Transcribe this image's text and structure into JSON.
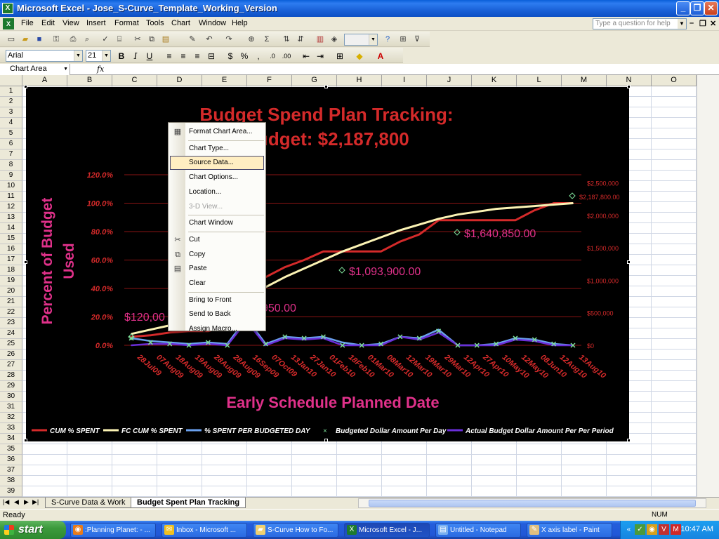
{
  "window": {
    "title": "Microsoft Excel - Jose_S-Curve_Template_Working_Version",
    "app_icon": "excel-icon"
  },
  "menu": {
    "items": [
      "File",
      "Edit",
      "View",
      "Insert",
      "Format",
      "Tools",
      "Chart",
      "Window",
      "Help"
    ],
    "ask_placeholder": "Type a question for help"
  },
  "format_toolbar": {
    "font": "Arial",
    "size": "21"
  },
  "formula_bar": {
    "name_box": "Chart Area",
    "fx": "fx"
  },
  "columns": [
    "A",
    "B",
    "C",
    "D",
    "E",
    "F",
    "G",
    "H",
    "I",
    "J",
    "K",
    "L",
    "M",
    "N",
    "O"
  ],
  "rows": [
    "1",
    "2",
    "3",
    "4",
    "5",
    "6",
    "7",
    "8",
    "9",
    "10",
    "11",
    "12",
    "13",
    "14",
    "15",
    "16",
    "17",
    "18",
    "19",
    "20",
    "21",
    "22",
    "23",
    "24",
    "25",
    "26",
    "27",
    "28",
    "29",
    "30",
    "31",
    "32",
    "33",
    "34",
    "35",
    "36",
    "37",
    "38",
    "39"
  ],
  "context_menu": {
    "items": [
      {
        "label": "Format Chart Area...",
        "icon": "format-chart-icon",
        "state": "normal"
      },
      {
        "label": "Chart Type...",
        "icon": "",
        "state": "normal"
      },
      {
        "label": "Source Data...",
        "icon": "",
        "state": "hover"
      },
      {
        "label": "Chart Options...",
        "icon": "",
        "state": "normal"
      },
      {
        "label": "Location...",
        "icon": "",
        "state": "normal"
      },
      {
        "label": "3-D View...",
        "icon": "",
        "state": "disabled"
      },
      {
        "label": "Chart Window",
        "icon": "",
        "state": "normal"
      },
      {
        "label": "Cut",
        "icon": "scissors-icon",
        "state": "normal"
      },
      {
        "label": "Copy",
        "icon": "copy-icon",
        "state": "normal"
      },
      {
        "label": "Paste",
        "icon": "paste-icon",
        "state": "normal"
      },
      {
        "label": "Clear",
        "icon": "",
        "state": "normal"
      },
      {
        "label": "Bring to Front",
        "icon": "",
        "state": "normal"
      },
      {
        "label": "Send to Back",
        "icon": "",
        "state": "normal"
      },
      {
        "label": "Assign Macro...",
        "icon": "",
        "state": "normal"
      }
    ]
  },
  "sheet_tabs": {
    "tabs": [
      "S-Curve Data & Work",
      "Budget Spent Plan Tracking"
    ],
    "active": 1
  },
  "status": {
    "text": "Ready",
    "num": "NUM"
  },
  "taskbar": {
    "start": "start",
    "tasks": [
      {
        "label": ":Planning Planet: - ...",
        "icon": "firefox-icon"
      },
      {
        "label": "Inbox - Microsoft ...",
        "icon": "outlook-icon"
      },
      {
        "label": "S-Curve How to Fo...",
        "icon": "folder-icon"
      },
      {
        "label": "Microsoft Excel - J...",
        "icon": "excel-icon"
      },
      {
        "label": "Untitled - Notepad",
        "icon": "notepad-icon"
      },
      {
        "label": "X axis label - Paint",
        "icon": "paint-icon"
      }
    ],
    "active_task": 3,
    "clock": "10:47 AM"
  },
  "chart_data": {
    "type": "line",
    "title_line1": "Budget Spend Plan Tracking:",
    "title_line2": "Budget: $2,187,800",
    "ylabel": "Percent of Budget Used",
    "xlabel": "Early Schedule Planned Date",
    "y_left_ticks": [
      "0.0%",
      "20.0%",
      "40.0%",
      "60.0%",
      "80.0%",
      "100.0%",
      "120.0%"
    ],
    "y_right_ticks": [
      "$0",
      "$500,000",
      "$1,000,000",
      "$1,500,000",
      "$2,000,000",
      "$2,500,000"
    ],
    "ylim": [
      0,
      1.2
    ],
    "categories": [
      "28Jul09",
      "07Aug09",
      "18Aug09",
      "19Aug09",
      "28Aug09",
      "28Aug09",
      "16Sep09",
      "07Oct09",
      "13Jan10",
      "27Jan10",
      "01Feb10",
      "18Feb10",
      "01Mar10",
      "08Mar10",
      "12Mar10",
      "19Mar10",
      "29Mar10",
      "12Apr10",
      "27Apr10",
      "10May10",
      "12May10",
      "08Jun10",
      "12Aug10",
      "13Aug10"
    ],
    "visible_tick_labels": [
      "28Jul09",
      "07Aug09",
      "18Aug09",
      "19Aug09",
      "28Aug09",
      "28Aug09",
      "16Sep09",
      "07Oct09",
      "13Jan10",
      "27Jan10",
      "01Feb10",
      "18Feb10",
      "01Mar10",
      "08Mar10",
      "12Mar10",
      "19Mar10",
      "29Mar10",
      "12Apr10",
      "27Apr10",
      "10May10",
      "12May10",
      "08Jun10",
      "12Aug10",
      "13Aug10"
    ],
    "series": [
      {
        "name": "CUM % SPENT",
        "color": "#d42a2a",
        "dash": "solid",
        "values": [
          0.06,
          0.07,
          0.09,
          0.1,
          0.1,
          0.14,
          0.47,
          0.48,
          0.55,
          0.6,
          0.66,
          0.66,
          0.66,
          0.66,
          0.73,
          0.78,
          0.88,
          0.88,
          0.88,
          0.88,
          0.88,
          0.95,
          1.0,
          1.0
        ]
      },
      {
        "name": "FC CUM % SPENT",
        "color": "#fbf3b4",
        "dash": "solid",
        "values": [
          0.08,
          0.11,
          0.14,
          0.17,
          0.21,
          0.25,
          0.34,
          0.41,
          0.48,
          0.54,
          0.6,
          0.66,
          0.71,
          0.76,
          0.81,
          0.85,
          0.89,
          0.92,
          0.94,
          0.96,
          0.97,
          0.98,
          0.99,
          1.0
        ]
      },
      {
        "name": "% SPENT PER BUDGETED DAY",
        "color": "#6aa0ee",
        "dash": "solid",
        "values": [
          0.05,
          0.03,
          0.02,
          0.01,
          0.02,
          0.01,
          0.19,
          0.01,
          0.06,
          0.05,
          0.06,
          0.02,
          0.0,
          0.01,
          0.06,
          0.05,
          0.11,
          0.0,
          0.0,
          0.01,
          0.05,
          0.04,
          0.01,
          0.0
        ]
      },
      {
        "name": "Actual Budget Dollar Amount Per Per Period",
        "color": "#6a2ed8",
        "dash": "solid",
        "values": [
          0.0,
          0.01,
          0.01,
          0.0,
          0.01,
          0.0,
          0.17,
          0.0,
          0.05,
          0.04,
          0.05,
          0.0,
          0.0,
          0.0,
          0.06,
          0.04,
          0.09,
          0.0,
          0.0,
          0.0,
          0.04,
          0.03,
          0.0,
          0.0
        ]
      }
    ],
    "marker_series": {
      "name": "Budgeted Dollar Amount Per Day",
      "color": "#7ee09a",
      "values": [
        0.05,
        0.02,
        0.01,
        0.0,
        0.02,
        0.0,
        0.17,
        0.01,
        0.06,
        0.05,
        0.06,
        0.0,
        0.0,
        0.01,
        0.06,
        0.05,
        0.1,
        0.0,
        0.0,
        0.01,
        0.05,
        0.04,
        0.01,
        0.0
      ]
    },
    "annotations": [
      {
        "text": "$120,00",
        "color": "#e0318a"
      },
      {
        "text": "950.00",
        "color": "#e0318a"
      },
      {
        "text": "$1,093,900.00",
        "color": "#e0318a"
      },
      {
        "text": "$1,640,850.00",
        "color": "#e0318a"
      },
      {
        "text": "$2,187,800.00",
        "color": "#d42a2a"
      }
    ],
    "legend_position": "bottom",
    "grid": true,
    "colors": {
      "background": "#000000",
      "title": "#d42a2a",
      "axis_label": "#e0318a",
      "tick_label": "#d42a2a",
      "gridline": "#8a1414"
    }
  }
}
